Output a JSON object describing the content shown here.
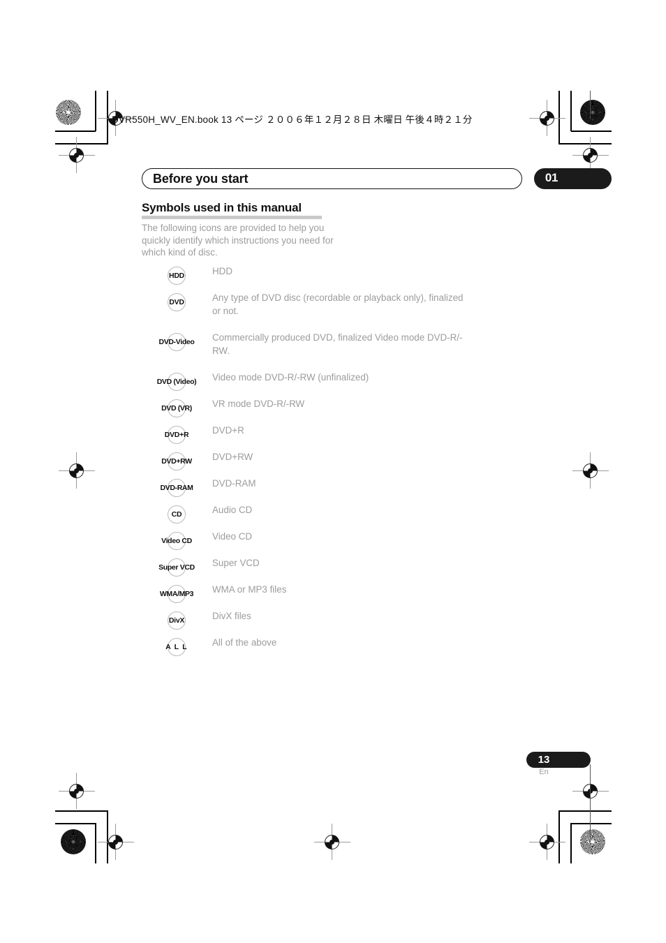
{
  "print_header": {
    "text": "DVR550H_WV_EN.book  13 ページ  ２００６年１２月２８日  木曜日  午後４時２１分"
  },
  "chapter": {
    "title": "Before you start",
    "number": "01"
  },
  "section": {
    "title": "Symbols used in this manual",
    "intro": "The following icons are provided to help you quickly identify which instructions you need for which kind of disc."
  },
  "symbols": [
    {
      "badge": "HDD",
      "desc": "HDD"
    },
    {
      "badge": "DVD",
      "desc": "Any type of DVD disc (recordable or playback only), finalized or not."
    },
    {
      "badge": "DVD-Video",
      "desc": "Commercially produced DVD, finalized Video mode DVD-R/-RW."
    },
    {
      "badge": "DVD (Video)",
      "desc": "Video mode DVD-R/-RW (unfinalized)"
    },
    {
      "badge": "DVD (VR)",
      "desc": "VR mode DVD-R/-RW"
    },
    {
      "badge": "DVD+R",
      "desc": "DVD+R"
    },
    {
      "badge": "DVD+RW",
      "desc": "DVD+RW"
    },
    {
      "badge": "DVD-RAM",
      "desc": "DVD-RAM"
    },
    {
      "badge": "CD",
      "desc": "Audio CD"
    },
    {
      "badge": "Video CD",
      "desc": "Video CD"
    },
    {
      "badge": "Super VCD",
      "desc": "Super VCD"
    },
    {
      "badge": "WMA/MP3",
      "desc": "WMA or MP3 files"
    },
    {
      "badge": "DivX",
      "desc": "DivX files"
    },
    {
      "badge": "A L L",
      "desc": "All of the above"
    }
  ],
  "footer": {
    "page_number": "13",
    "language": "En"
  },
  "colors": {
    "ink": "#111111",
    "body_text": "#9c9c9c",
    "rule": "#c9c9c9",
    "badge_border": "#b9b9b9",
    "pill_fill": "#1b1b1b"
  }
}
